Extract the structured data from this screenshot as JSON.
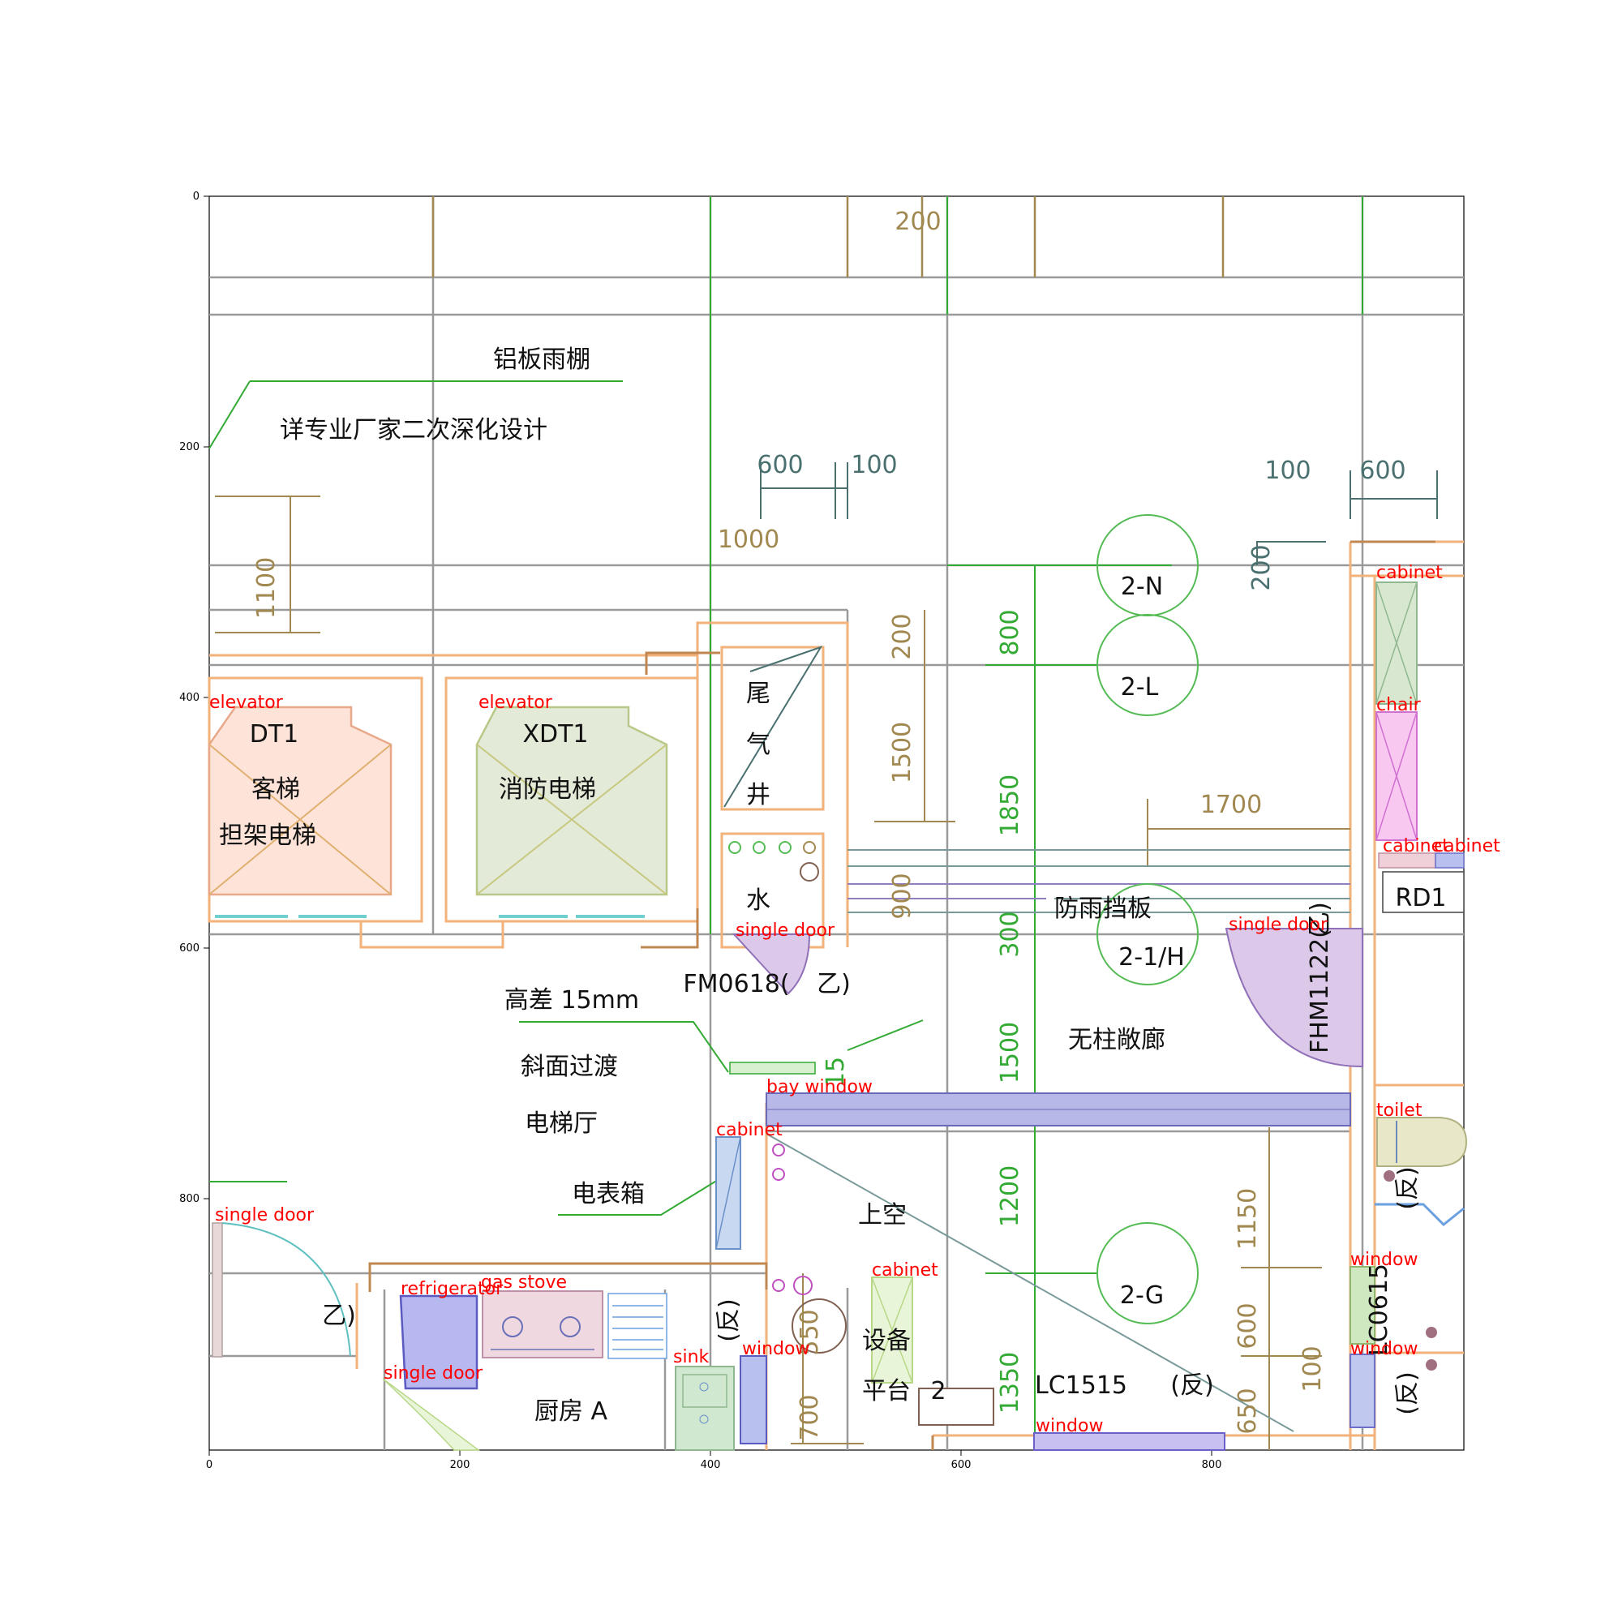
{
  "axes": {
    "x_ticks": [
      "0",
      "200",
      "400",
      "600",
      "800"
    ],
    "y_ticks": [
      "0",
      "200",
      "400",
      "600",
      "800"
    ]
  },
  "room_labels": {
    "canopy": "铝板雨棚",
    "canopy_note": "详专业厂家二次深化设计",
    "dt1": "DT1",
    "passenger_lift": "客梯",
    "stretcher_lift": "担架电梯",
    "xdt1": "XDT1",
    "fire_lift": "消防电梯",
    "flue_1": "尾",
    "flue_2": "气",
    "flue_3": "井",
    "water": "水",
    "level_diff": "高差 15mm",
    "slope": "斜面过渡",
    "lift_hall": "电梯厅",
    "meter_box": "电表箱",
    "rain_board": "防雨挡板",
    "corridor": "无柱敞廊",
    "void": "上空",
    "equipment": "设备",
    "platform": "平台",
    "platform_no": "2",
    "kitchen": "厨房 A",
    "door_fm0618": "FM0618(",
    "door_fm0618_b": "乙)",
    "door_fhm1122": "FHM1122(",
    "door_fhm1122_b": "乙)",
    "yi": "乙)",
    "fan_1": "(反)",
    "fan_2": "(反)",
    "fan_3": "(反)",
    "fan_4": "(反)",
    "lc1515": "LC1515",
    "lc0615": "LC0615",
    "rd1": "RD1"
  },
  "axis_labels": {
    "a1": "2-N",
    "a2": "2-L",
    "a3": "2-1/H",
    "a4": "2-G"
  },
  "dimensions": {
    "d200_top": "200",
    "d600_left": "600",
    "d100_left": "100",
    "d1000": "1000",
    "d100_right": "100",
    "d600_right": "600",
    "d200_right": "200",
    "d1100": "1100",
    "d200_v": "200",
    "d1500_v": "1500",
    "d900_v": "900",
    "d800_g": "800",
    "d1850_g": "1850",
    "d300_g": "300",
    "d1500_g": "1500",
    "d1200_g": "1200",
    "d1350_g": "1350",
    "d1700": "1700",
    "d1150": "1150",
    "d600_b": "600",
    "d100_b": "100",
    "d650": "650",
    "d550": "550",
    "d700": "700",
    "d15": "15"
  },
  "annotations": {
    "elevator_1": "elevator",
    "elevator_2": "elevator",
    "cabinet_top": "cabinet",
    "chair": "chair",
    "cabinet_r1": "cabinet",
    "cabinet_r2": "cabinet",
    "single_door_1": "single door",
    "single_door_2": "single door",
    "single_door_3": "single door",
    "single_door_4": "single door",
    "bay_window": "bay window",
    "cabinet_mid": "cabinet",
    "toilet": "toilet",
    "refrigerator": "refrigerator",
    "gas_stove": "gas stove",
    "cabinet_eq": "cabinet",
    "window_1": "window",
    "window_2": "window",
    "window_3": "window",
    "window_4": "window",
    "sink": "sink"
  },
  "colors": {
    "wall": "#f2b27a",
    "grid": "#9a9a9a",
    "dim": "#a08850",
    "green_dim": "#33aa33",
    "annotation": "#ff0000"
  }
}
